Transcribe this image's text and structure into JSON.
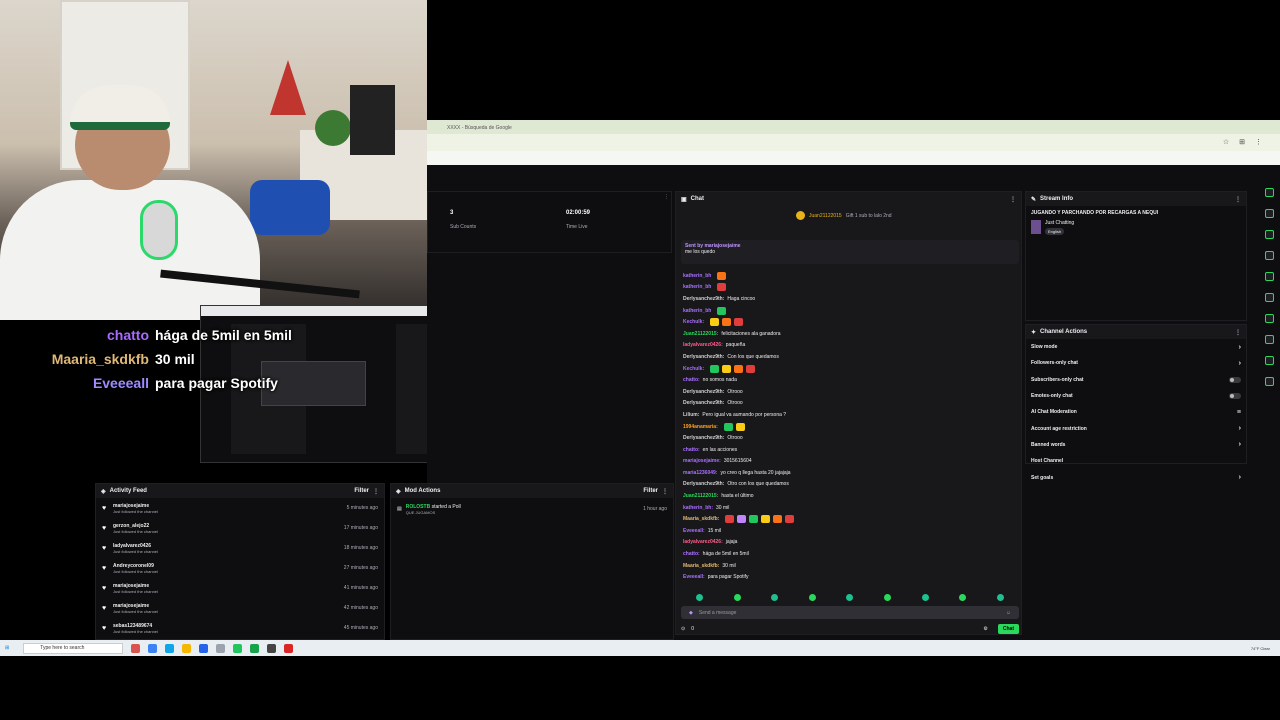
{
  "overlay_chat": [
    {
      "user": "chatto",
      "color": "#a86bff",
      "msg": "hága de 5mil en 5mil"
    },
    {
      "user": "Maaria_skdkfb",
      "color": "#e0b876",
      "msg": "30 mil"
    },
    {
      "user": "Eveeeall",
      "color": "#9c8cff",
      "msg": "para pagar Spotify"
    }
  ],
  "stats": {
    "sub_counts_value": "3",
    "sub_counts_label": "Sub Counts",
    "time_live_value": "02:00:59",
    "time_live_label": "Time Live"
  },
  "chat": {
    "header": "Chat",
    "hype_user": "Juan21122015",
    "hype_text": "Gift 1 sub to lalo 2nd",
    "pinned_by": "Sent by mariajosejaime",
    "pinned_msg": "me los quedo",
    "input_placeholder": "Send a message",
    "points": "0",
    "chat_button": "Chat",
    "messages": [
      {
        "u": "katherin_bh",
        "c": "#a970ff",
        "t": "",
        "e": 1
      },
      {
        "u": "katherin_bh",
        "c": "#a970ff",
        "t": "",
        "e": 1
      },
      {
        "u": "Derlysanchez9th:",
        "c": "#d2d2d2",
        "t": "Haga cincoo",
        "e": 0
      },
      {
        "u": "katherin_bh",
        "c": "#a970ff",
        "t": "",
        "e": 1
      },
      {
        "u": "Kechulk:",
        "c": "#a970ff",
        "t": "",
        "e": 3
      },
      {
        "u": "Juan21122015:",
        "c": "#2ad95c",
        "t": "felicitaciones ala ganadora",
        "e": 0
      },
      {
        "u": "ladyalvarez0426:",
        "c": "#ff5c8a",
        "t": "paqueña",
        "e": 0
      },
      {
        "u": "Derlysanchez9th:",
        "c": "#d2d2d2",
        "t": "Con los que quedamos",
        "e": 0
      },
      {
        "u": "Kechulk:",
        "c": "#a970ff",
        "t": "",
        "e": 4
      },
      {
        "u": "chatto:",
        "c": "#a970ff",
        "t": "no somos nada",
        "e": 0
      },
      {
        "u": "Derlysanchez9th:",
        "c": "#d2d2d2",
        "t": "Otrooo",
        "e": 0
      },
      {
        "u": "Derlysanchez9th:",
        "c": "#d2d2d2",
        "t": "Otrooo",
        "e": 0
      },
      {
        "u": "Lilium:",
        "c": "#d2d2d2",
        "t": "Pero igual va aumando por persona ?",
        "e": 0
      },
      {
        "u": "1994anamaria:",
        "c": "#ff9f1a",
        "t": "",
        "e": 2
      },
      {
        "u": "Derlysanchez9th:",
        "c": "#d2d2d2",
        "t": "Otrooo",
        "e": 0
      },
      {
        "u": "chatto:",
        "c": "#a970ff",
        "t": "en las acciones",
        "e": 0
      },
      {
        "u": "mariajosejaime:",
        "c": "#a970ff",
        "t": "3015615604",
        "e": 0
      },
      {
        "u": "maria1236049:",
        "c": "#a970ff",
        "t": "yo creo q llega hasta 20 jajajaja",
        "e": 0
      },
      {
        "u": "Derlysanchez9th:",
        "c": "#d2d2d2",
        "t": "Otro con los que quedamos",
        "e": 0
      },
      {
        "u": "Juan21122015:",
        "c": "#2ad95c",
        "t": "hasta el último",
        "e": 0
      },
      {
        "u": "katherin_bh:",
        "c": "#a970ff",
        "t": "30 mil",
        "e": 0
      },
      {
        "u": "Maaria_skdkfb:",
        "c": "#e0b876",
        "t": "",
        "e": 6
      },
      {
        "u": "Eveeeall:",
        "c": "#a970ff",
        "t": "15 mil",
        "e": 0
      },
      {
        "u": "ladyalvarez0426:",
        "c": "#ff5c8a",
        "t": "jajaja",
        "e": 0
      },
      {
        "u": "chatto:",
        "c": "#a970ff",
        "t": "hága de 5mil en 5mil",
        "e": 0
      },
      {
        "u": "Maaria_skdkfb:",
        "c": "#e0b876",
        "t": "30 mil",
        "e": 0
      },
      {
        "u": "Eveeeall:",
        "c": "#a970ff",
        "t": "para pagar Spotify",
        "e": 0
      }
    ]
  },
  "stream_info": {
    "header": "Stream Info",
    "title": "JUGANDO Y PARCHANDO POR RECARGAS A NEQUI",
    "category": "Just Chatting",
    "tag": "English"
  },
  "channel_actions": {
    "header": "Channel Actions",
    "items": [
      "Slow mode",
      "Followers-only chat",
      "Subscribers-only chat",
      "Emotes-only chat",
      "AI Chat Moderation",
      "Account age restriction",
      "Banned words",
      "Host Channel",
      "Set goals"
    ]
  },
  "activity_feed": {
    "header": "Activity Feed",
    "filter": "Filter",
    "sub_text": "Just followed the channel",
    "items": [
      {
        "user": "mariajosejaime",
        "time": "5 minutes ago"
      },
      {
        "user": "gerzon_alejo22",
        "time": "17 minutes ago"
      },
      {
        "user": "ladyalvarez0426",
        "time": "18 minutes ago"
      },
      {
        "user": "Andreycoronel09",
        "time": "27 minutes ago"
      },
      {
        "user": "mariajosejaime",
        "time": "41 minutes ago"
      },
      {
        "user": "mariajosejaime",
        "time": "42 minutes ago"
      },
      {
        "user": "sebas123489674",
        "time": "45 minutes ago"
      }
    ]
  },
  "mod_actions": {
    "header": "Mod Actions",
    "filter": "Filter",
    "item_user": "ROLOSTB",
    "item_text": "started a Poll",
    "item_sub": "QUE JUGAMOS",
    "item_time": "1 hour ago"
  },
  "taskbar": {
    "search_placeholder": "Type here to search",
    "tray": "74°F Clear"
  },
  "browser": {
    "tab_title": "XXXX - Búsqueda de Google"
  }
}
